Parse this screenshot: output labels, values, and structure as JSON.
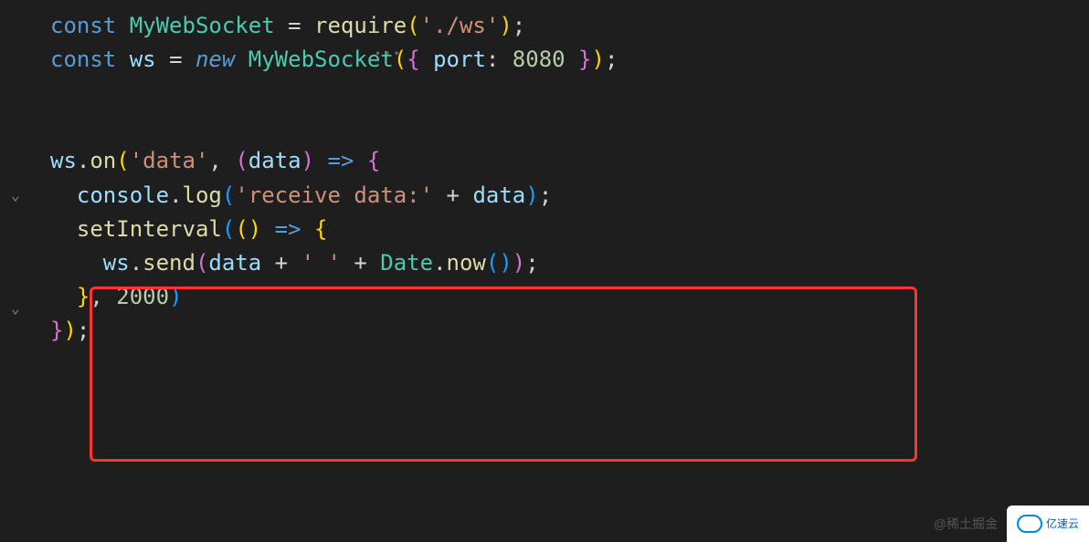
{
  "code": {
    "line1": {
      "const": "const",
      "name": "MyWebSocket",
      "eq": "=",
      "require": "require",
      "lp": "(",
      "path": "'./ws'",
      "rp": ")",
      "semi": ";"
    },
    "line2": {
      "const": "const",
      "name": "ws",
      "eq": "=",
      "new": "new",
      "cls": "MyWebSocket",
      "lp": "(",
      "lb": "{",
      "prop": "port",
      "colon": ":",
      "val": "8080",
      "rb": "}",
      "rp": ")",
      "semi": ";"
    },
    "line3": {},
    "line4": {},
    "line5": {
      "obj": "ws",
      "dot": ".",
      "method": "on",
      "lp": "(",
      "event": "'data'",
      "comma": ",",
      "lp2": "(",
      "param": "data",
      "rp2": ")",
      "arrow": "=>",
      "lb": "{"
    },
    "line6": {
      "obj": "console",
      "dot": ".",
      "method": "log",
      "lp": "(",
      "str": "'receive data:'",
      "plus": "+",
      "var": "data",
      "rp": ")",
      "semi": ";"
    },
    "line7": {
      "fn": "setInterval",
      "lp": "(",
      "lp2": "(",
      "rp2": ")",
      "arrow": "=>",
      "lb": "{"
    },
    "line8": {
      "obj": "ws",
      "dot": ".",
      "method": "send",
      "lp": "(",
      "var": "data",
      "plus1": "+",
      "str": "' '",
      "plus2": "+",
      "cls": "Date",
      "dot2": ".",
      "method2": "now",
      "lp2": "(",
      "rp2": ")",
      "rp": ")",
      "semi": ";"
    },
    "line9": {
      "rb": "}",
      "comma": ",",
      "delay": "2000",
      "rp": ")"
    },
    "line10": {
      "rb": "}",
      "rp": ")",
      "semi": ";"
    }
  },
  "watermark": {
    "text": "@稀土掘金",
    "logo": "亿速云"
  }
}
